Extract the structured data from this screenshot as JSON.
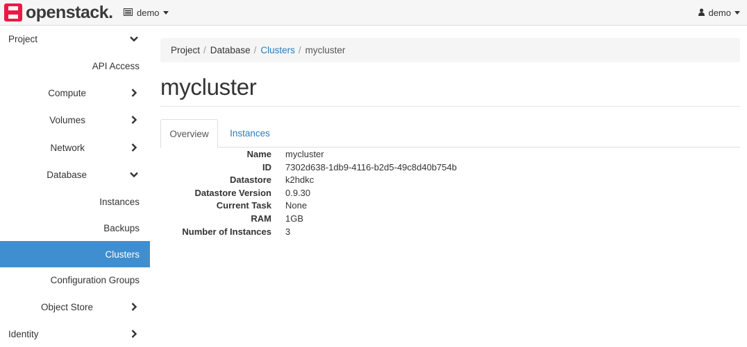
{
  "navbar": {
    "brand": "openstack",
    "brand_dot": ".",
    "project_menu": "demo",
    "user_menu": "demo",
    "icons": {
      "project": "list-icon",
      "user": "user-icon",
      "logo": "openstack-logo"
    }
  },
  "sidebar": {
    "items": [
      {
        "label": "Project",
        "chevron": "down"
      },
      {
        "label": "API Access",
        "chevron": "none"
      },
      {
        "label": "Compute",
        "chevron": "right"
      },
      {
        "label": "Volumes",
        "chevron": "right"
      },
      {
        "label": "Network",
        "chevron": "right"
      },
      {
        "label": "Database",
        "chevron": "down"
      },
      {
        "label": "Instances",
        "chevron": "none"
      },
      {
        "label": "Backups",
        "chevron": "none"
      },
      {
        "label": "Clusters",
        "chevron": "none",
        "active": true
      },
      {
        "label": "Configuration Groups",
        "chevron": "none"
      },
      {
        "label": "Object Store",
        "chevron": "right"
      },
      {
        "label": "Identity",
        "chevron": "right"
      }
    ],
    "active_color": "#3f8ed0"
  },
  "breadcrumb": {
    "items": [
      "Project",
      "Database",
      "Clusters",
      "mycluster"
    ],
    "separator": "/"
  },
  "page": {
    "title": "mycluster"
  },
  "tabs": [
    {
      "label": "Overview",
      "active": true
    },
    {
      "label": "Instances",
      "active": false
    }
  ],
  "details": [
    {
      "label": "Name",
      "value": "mycluster"
    },
    {
      "label": "ID",
      "value": "7302d638-1db9-4116-b2d5-49c8d40b754b"
    },
    {
      "label": "Datastore",
      "value": "k2hdkc"
    },
    {
      "label": "Datastore Version",
      "value": "0.9.30"
    },
    {
      "label": "Current Task",
      "value": "None"
    },
    {
      "label": "RAM",
      "value": "1GB"
    },
    {
      "label": "Number of Instances",
      "value": "3"
    }
  ],
  "colors": {
    "link": "#2a7bbf",
    "logo_red": "#ed1944"
  }
}
